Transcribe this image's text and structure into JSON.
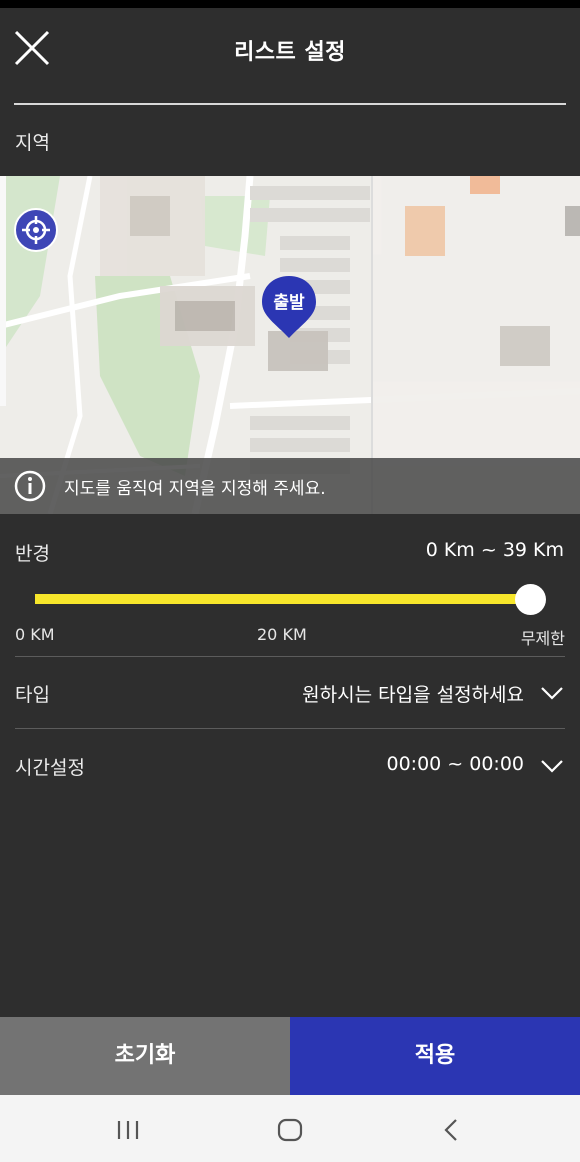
{
  "header": {
    "title": "리스트 설정"
  },
  "region": {
    "label": "지역",
    "marker_label": "출발",
    "hint": "지도를 움직여 지역을 지정해 주세요."
  },
  "radius": {
    "label": "반경",
    "value_text": "0 Km ~ 39 Km",
    "slider_fraction": 1.0,
    "ticks": {
      "min": "0 KM",
      "mid": "20 KM",
      "max": "무제한"
    }
  },
  "type": {
    "label": "타입",
    "value": "원하시는 타입을 설정하세요"
  },
  "time": {
    "label": "시간설정",
    "value": "00:00 ~ 00:00"
  },
  "actions": {
    "reset": "초기화",
    "apply": "적용"
  },
  "icons": {
    "close": "close-icon",
    "locate": "crosshair-icon",
    "marker": "map-pin-icon",
    "info": "info-icon",
    "chevron": "chevron-down-icon",
    "nav_recent": "recent-apps-icon",
    "nav_home": "home-icon",
    "nav_back": "back-icon"
  },
  "colors": {
    "background": "#2e2e2e",
    "accent_blue": "#2b36b3",
    "slider_yellow": "#f7e62b",
    "reset_gray": "#737373"
  }
}
